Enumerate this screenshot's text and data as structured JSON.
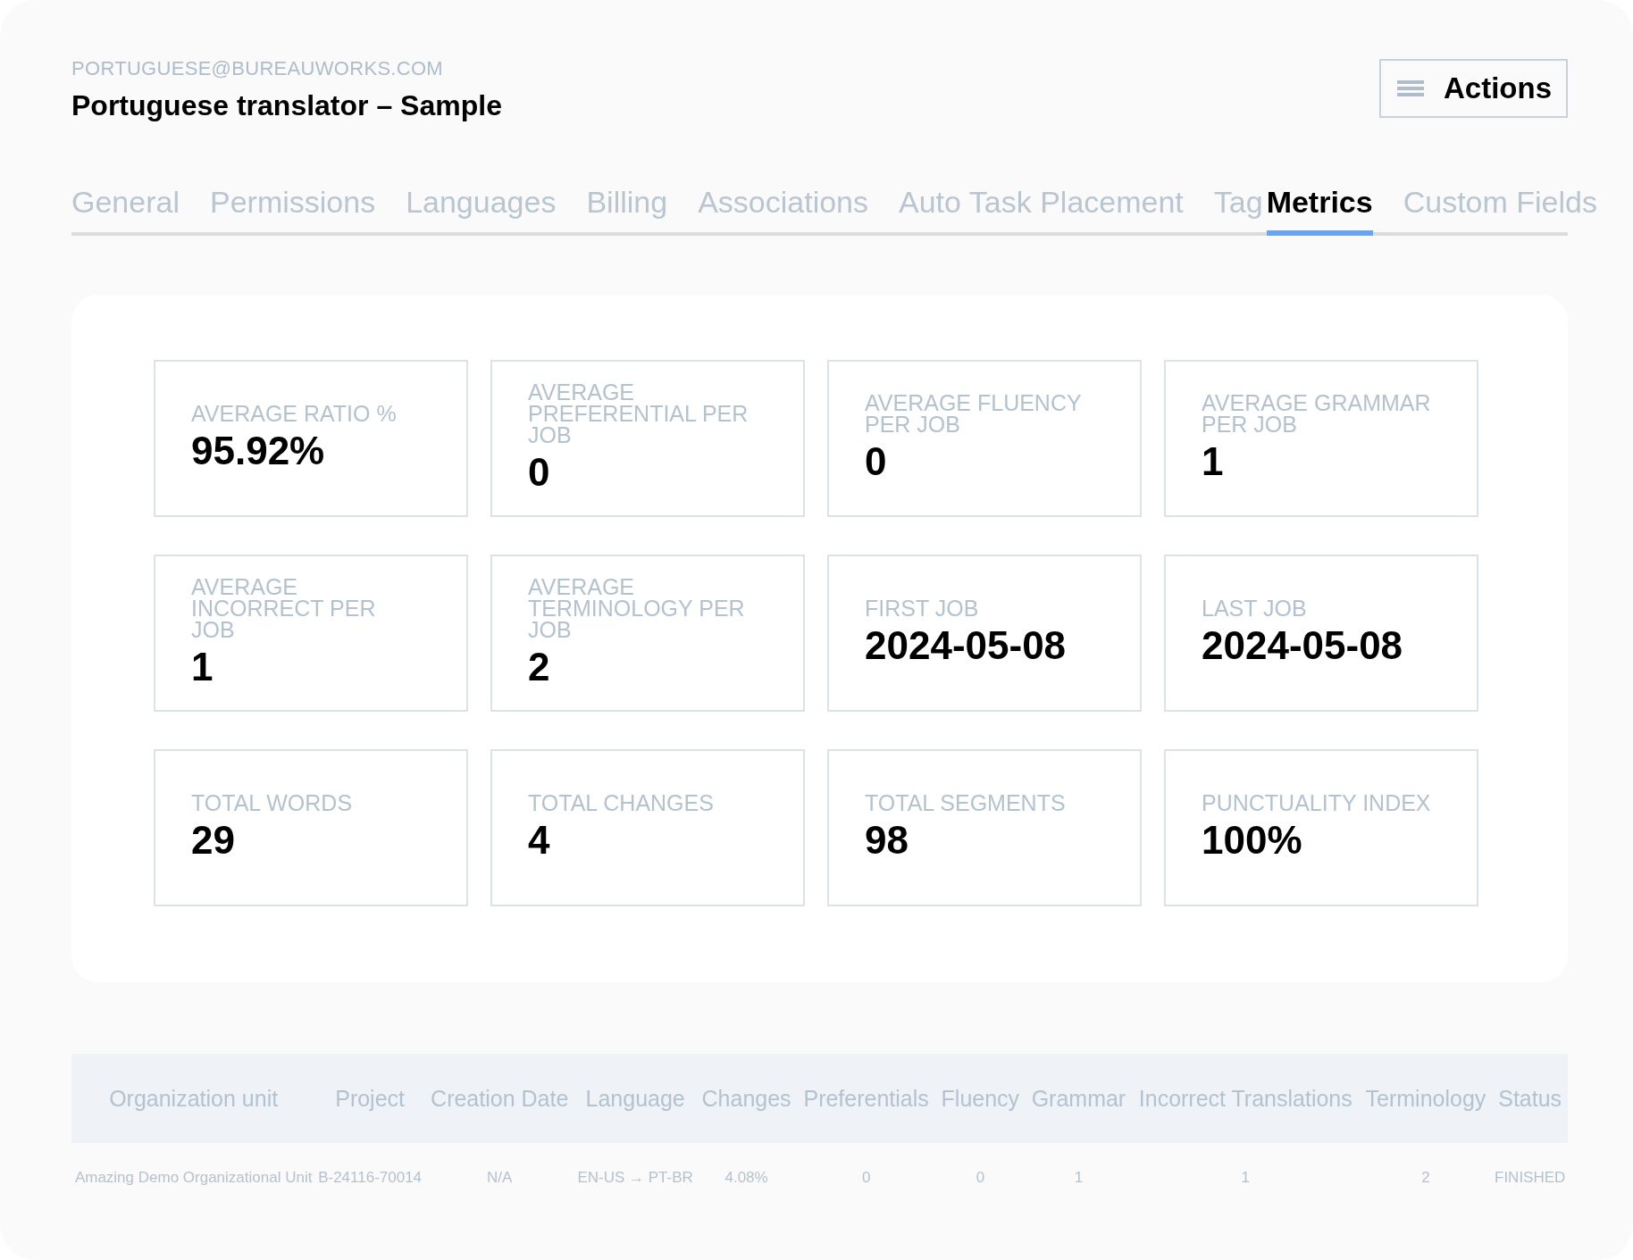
{
  "header": {
    "email": "PORTUGUESE@BUREAUWORKS.COM",
    "title": "Portuguese translator – Sample",
    "actions_button": "Actions"
  },
  "tabs": [
    {
      "label": "General",
      "selected": false
    },
    {
      "label": "Permissions",
      "selected": false
    },
    {
      "label": "Languages",
      "selected": false
    },
    {
      "label": "Billing",
      "selected": false
    },
    {
      "label": "Associations",
      "selected": false
    },
    {
      "label": "Auto Task Placement",
      "selected": false
    },
    {
      "label": "Tag",
      "selected": false
    },
    {
      "label": "Metrics",
      "selected": true
    },
    {
      "label": "Custom Fields",
      "selected": false
    }
  ],
  "metrics": [
    {
      "label": "AVERAGE RATIO %",
      "value": "95.92%"
    },
    {
      "label": "AVERAGE PREFERENTIAL PER JOB",
      "value": "0"
    },
    {
      "label": "AVERAGE FLUENCY PER JOB",
      "value": "0"
    },
    {
      "label": "AVERAGE GRAMMAR PER JOB",
      "value": "1"
    },
    {
      "label": "AVERAGE INCORRECT PER JOB",
      "value": "1"
    },
    {
      "label": "AVERAGE TERMINOLOGY PER JOB",
      "value": "2"
    },
    {
      "label": "FIRST JOB",
      "value": "2024-05-08"
    },
    {
      "label": "LAST JOB",
      "value": "2024-05-08"
    },
    {
      "label": "TOTAL WORDS",
      "value": "29"
    },
    {
      "label": "TOTAL CHANGES",
      "value": "4"
    },
    {
      "label": "TOTAL SEGMENTS",
      "value": "98"
    },
    {
      "label": "PUNCTUALITY INDEX",
      "value": "100%"
    }
  ],
  "table": {
    "columns": [
      "Organization unit",
      "Project",
      "Creation Date",
      "Language",
      "Changes",
      "Preferentials",
      "Fluency",
      "Grammar",
      "Incorrect Translations",
      "Terminology",
      "Status"
    ],
    "rows": [
      [
        "Amazing Demo Organizational Unit",
        "B-24116-70014",
        "N/A",
        "EN-US → PT-BR",
        "4.08%",
        "0",
        "0",
        "1",
        "1",
        "2",
        "FINISHED"
      ]
    ]
  }
}
